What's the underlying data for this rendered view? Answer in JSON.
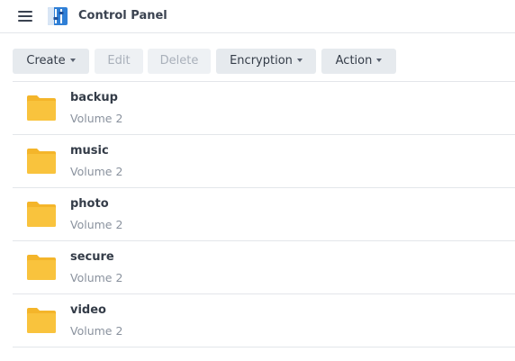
{
  "header": {
    "title": "Control Panel",
    "menu_icon": "hamburger-menu-icon",
    "app_icon": "control-panel-icon"
  },
  "toolbar": {
    "create_label": "Create",
    "edit_label": "Edit",
    "delete_label": "Delete",
    "encryption_label": "Encryption",
    "action_label": "Action"
  },
  "folders": [
    {
      "name": "backup",
      "location": "Volume 2"
    },
    {
      "name": "music",
      "location": "Volume 2"
    },
    {
      "name": "photo",
      "location": "Volume 2"
    },
    {
      "name": "secure",
      "location": "Volume 2"
    },
    {
      "name": "video",
      "location": "Volume 2"
    }
  ],
  "colors": {
    "folder": "#f9c33d",
    "folder_tab": "#f4b52a",
    "button_bg": "#e6eaee",
    "button_disabled_text": "#a9b0ba",
    "subtext": "#8a929e"
  }
}
